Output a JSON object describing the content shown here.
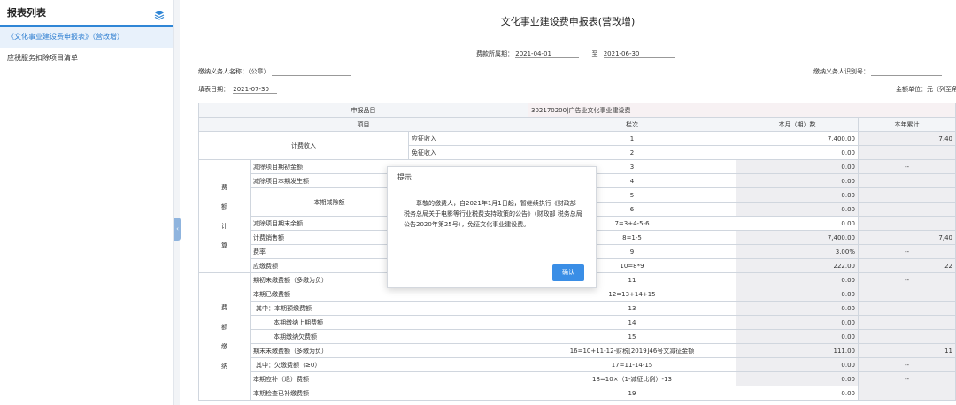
{
  "sidebar": {
    "title": "报表列表",
    "items": [
      {
        "label": "《文化事业建设费申报表》（营改增）"
      },
      {
        "label": "应税服务扣除项目清单"
      }
    ]
  },
  "doc": {
    "title": "文化事业建设费申报表(营改增)",
    "period_label": "费款所属期：",
    "period_start": "2021-04-01",
    "period_to": "至",
    "period_end": "2021-06-30",
    "taxpayer_name_label": "缴纳义务人名称：（公章）",
    "taxpayer_id_label": "缴纳义务人识别号：",
    "fill_date_label": "填表日期：",
    "fill_date": "2021-07-30",
    "unit_label": "金额单位：元（列至角"
  },
  "table": {
    "item_code_label": "申报品目",
    "item_code_value": "302170200|广告业文化事业建设费",
    "headers": {
      "project": "项目",
      "col": "栏次",
      "month": "本月（期）数",
      "year": "本年累计"
    },
    "income": {
      "group": "计费收入",
      "rows": [
        {
          "label": "应征收入",
          "col": "1",
          "month": "7,400.00",
          "year": "7,40"
        },
        {
          "label": "免征收入",
          "col": "2",
          "month": "0.00",
          "year": ""
        }
      ]
    },
    "calc": {
      "group": [
        "费",
        "额",
        "计",
        "算"
      ],
      "rows": [
        {
          "label": "减除项目期初金额",
          "col": "3",
          "month": "0.00",
          "year": "--"
        },
        {
          "label": "减除项目本期发生额",
          "col": "4",
          "month": "0.00",
          "year": ""
        },
        {
          "label": "",
          "col": "5",
          "month": "0.00",
          "year": ""
        },
        {
          "label": "",
          "col": "6",
          "month": "0.00",
          "year": ""
        },
        {
          "label": "减除项目期末余额",
          "col": "7=3+4-5-6",
          "month": "0.00",
          "year": ""
        },
        {
          "label": "计费销售额",
          "col": "8=1-5",
          "month": "7,400.00",
          "year": "7,40"
        },
        {
          "label": "费率",
          "col": "9",
          "month": "3.00%",
          "year": "--"
        },
        {
          "label": "应缴费额",
          "col": "10=8*9",
          "month": "222.00",
          "year": "22"
        }
      ],
      "deduct_label": "本期减除额"
    },
    "pay": {
      "group": [
        "费",
        "额",
        "缴",
        "纳"
      ],
      "rows": [
        {
          "label": "期初未缴费额（多缴为负）",
          "col": "11",
          "month": "0.00",
          "year": "--"
        },
        {
          "label": "本期已缴费额",
          "col": "12=13+14+15",
          "month": "0.00",
          "year": ""
        },
        {
          "label": "其中：本期预缴费额",
          "col": "13",
          "month": "0.00",
          "year": ""
        },
        {
          "label": "本期缴纳上期费额",
          "col": "14",
          "month": "0.00",
          "year": ""
        },
        {
          "label": "本期缴纳欠费额",
          "col": "15",
          "month": "0.00",
          "year": ""
        },
        {
          "label": "期末未缴费额（多缴为负）",
          "col": "16=10+11-12-财税[2019]46号文减征金额",
          "month": "111.00",
          "year": "11"
        },
        {
          "label": "其中：欠缴费额（≥0）",
          "col": "17=11-14-15",
          "month": "0.00",
          "year": "--"
        },
        {
          "label": "本期应补（退）费额",
          "col": "18=10×（1-减征比例）-13",
          "month": "0.00",
          "year": "--"
        },
        {
          "label": "本期检查已补缴费额",
          "col": "19",
          "month": "0.00",
          "year": ""
        }
      ]
    }
  },
  "modal": {
    "title": "提示",
    "message": "尊敬的缴费人，自2021年1月1日起，暂继续执行《财政部 税务总局关于电影等行业税费支持政策的公告》（财政部 税务总局公告2020年第25号），免征文化事业建设费。",
    "confirm": "确认"
  },
  "colors": {
    "accent": "#3a8ee6",
    "active_bg": "#e8f1fb",
    "readonly": "#eeeef1"
  }
}
